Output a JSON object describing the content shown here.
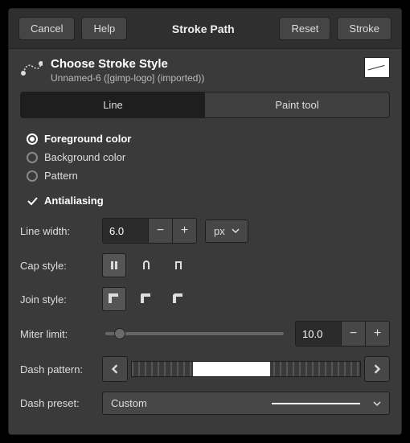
{
  "titlebar": {
    "cancel": "Cancel",
    "help": "Help",
    "title": "Stroke Path",
    "reset": "Reset",
    "stroke": "Stroke"
  },
  "header": {
    "title": "Choose Stroke Style",
    "subtitle": "Unnamed-6 ([gimp-logo] (imported))"
  },
  "tabs": {
    "line": "Line",
    "paint_tool": "Paint tool"
  },
  "stroke_source": {
    "foreground": "Foreground color",
    "background": "Background color",
    "pattern": "Pattern",
    "selected": "foreground"
  },
  "antialiasing": {
    "label": "Antialiasing",
    "checked": true
  },
  "line_width": {
    "label": "Line width:",
    "value": "6.0",
    "unit": "px"
  },
  "cap_style": {
    "label": "Cap style:"
  },
  "join_style": {
    "label": "Join style:"
  },
  "miter_limit": {
    "label": "Miter limit:",
    "value": "10.0",
    "slider_pct": 8
  },
  "dash_pattern": {
    "label": "Dash pattern:"
  },
  "dash_preset": {
    "label": "Dash preset:",
    "value": "Custom"
  }
}
